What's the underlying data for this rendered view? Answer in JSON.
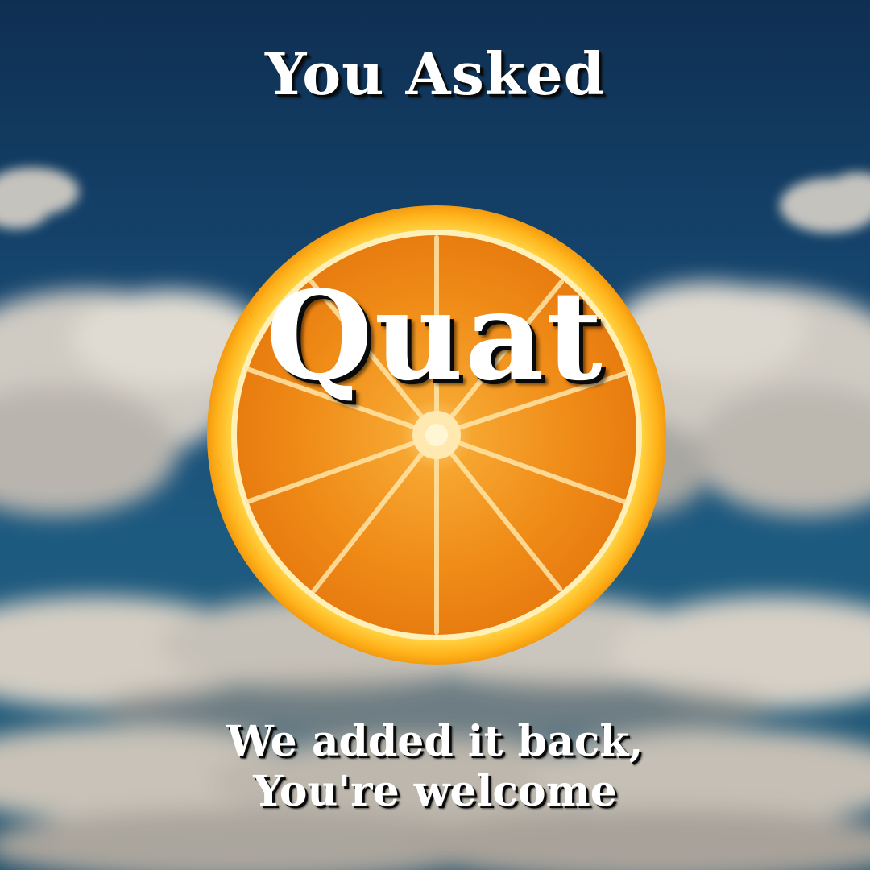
{
  "poster": {
    "heading": "You Asked",
    "feature_word": "Quat",
    "caption_line_1": "We added it back,",
    "caption_line_2": "You're welcome"
  },
  "colors": {
    "sky_top": "#0f2f52",
    "sky_bottom": "#1f4f6c",
    "cloud": "#d9d6d0",
    "orange_peel": "#ffb419",
    "orange_flesh": "#f08a14",
    "text": "#ffffff",
    "text_shadow": "#0a0a0a"
  }
}
